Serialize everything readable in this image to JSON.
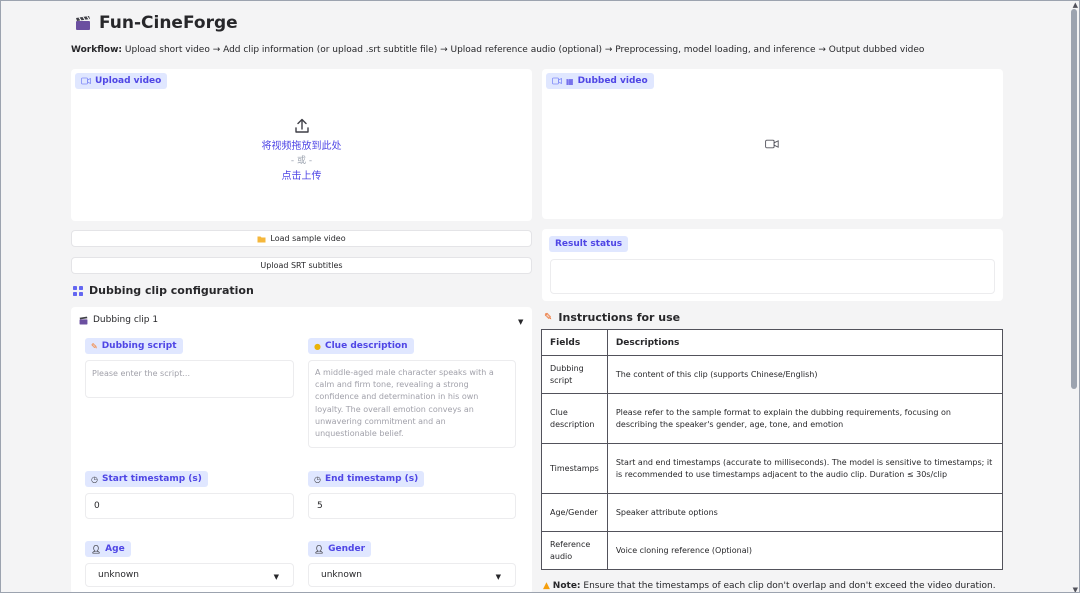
{
  "app": {
    "title": "Fun-CineForge",
    "workflow_label": "Workflow:",
    "workflow_text": "Upload short video → Add clip information (or upload .srt subtitle file) → Upload reference audio (optional) → Preprocessing, model loading, and inference → Output dubbed video"
  },
  "upload": {
    "label": "Upload video",
    "drop_text": "将视频拖放到此处",
    "or_text": "- 或 -",
    "click_text": "点击上传"
  },
  "buttons": {
    "load_sample": "Load sample video",
    "upload_srt": "Upload SRT subtitles"
  },
  "dubbed": {
    "label": "Dubbed video"
  },
  "result": {
    "label": "Result status"
  },
  "config": {
    "title": "Dubbing clip configuration",
    "clip_title": "Dubbing clip 1",
    "script_label": "Dubbing script",
    "script_placeholder": "Please enter the script...",
    "clue_label": "Clue description",
    "clue_placeholder": "A middle-aged male character speaks with a calm and firm tone, revealing a strong confidence and determination in his own loyalty. The overall emotion conveys an unwavering commitment and an unquestionable belief.",
    "start_label": "Start timestamp (s)",
    "start_value": "0",
    "end_label": "End timestamp (s)",
    "end_value": "5",
    "age_label": "Age",
    "age_value": "unknown",
    "gender_label": "Gender",
    "gender_value": "unknown"
  },
  "instructions": {
    "title": "Instructions for use",
    "header_field": "Fields",
    "header_desc": "Descriptions",
    "rows": [
      {
        "field": "Dubbing script",
        "desc": "The content of this clip (supports Chinese/English)"
      },
      {
        "field": "Clue description",
        "desc": "Please refer to the sample format to explain the dubbing requirements, focusing on describing the speaker's gender, age, tone, and emotion"
      },
      {
        "field": "Timestamps",
        "desc": "Start and end timestamps (accurate to milliseconds). The model is sensitive to timestamps; it is recommended to use timestamps adjacent to the audio clip. Duration ≤ 30s/clip"
      },
      {
        "field": "Age/Gender",
        "desc": "Speaker attribute options"
      },
      {
        "field": "Reference audio",
        "desc": "Voice cloning reference (Optional)"
      }
    ],
    "note_label": "Note:",
    "note_text": "Ensure that the timestamps of each clip don't overlap and don't exceed the video duration."
  },
  "colors": {
    "accent": "#4f46e5",
    "pill_bg": "#e0e7ff",
    "page_bg": "#f4f4f5"
  },
  "icons": [
    "clapperboard-icon",
    "upload-icon",
    "video-camera-icon",
    "folder-icon",
    "grid-icon",
    "memo-icon",
    "bulb-icon",
    "stopwatch-icon",
    "person-icon",
    "warning-icon",
    "caret-down-icon"
  ]
}
